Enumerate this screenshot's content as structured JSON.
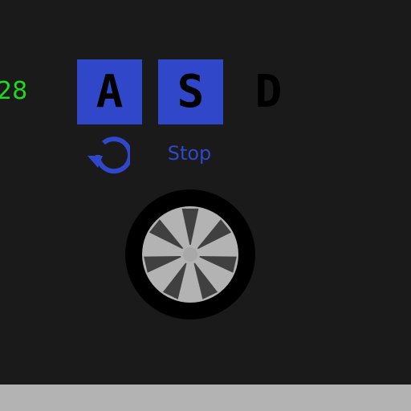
{
  "hud": {
    "score": "28"
  },
  "controls": {
    "keys": [
      {
        "label": "A",
        "state": "pressed"
      },
      {
        "label": "S",
        "state": "pressed"
      },
      {
        "label": "D",
        "state": "released"
      }
    ],
    "restart_icon": "restart-icon",
    "stop_label": "Stop"
  },
  "colors": {
    "background": "#1a1a1a",
    "ground": "#b3b3b3",
    "key_active": "#3047c9",
    "score_text": "#1cdb1c",
    "accent": "#3047c9",
    "tire": "#000000",
    "rim": "#b3b3b3",
    "spoke": "#404040"
  },
  "wheel": {
    "spoke_count": 7
  }
}
